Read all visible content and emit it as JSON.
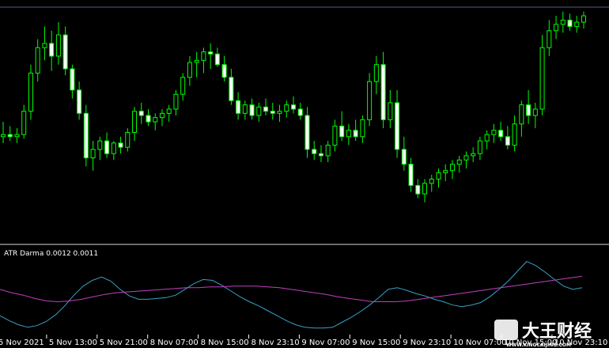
{
  "indicator": {
    "title": "ATR Darma 0.0012 0.0011"
  },
  "colors": {
    "background": "#000000",
    "candle_bull": "#00ff00",
    "candle_bear": "#00ff00",
    "candle_bull_fill": "#000000",
    "candle_bear_fill": "#ffffff",
    "indicator_fast": "#3aa0c8",
    "indicator_slow": "#c040c0",
    "separator": "#d8d8d8",
    "text": "#ffffff"
  },
  "watermark": {
    "text": "大王财经",
    "url_text": "WWW.KINGCAIJING.COM"
  },
  "chart_data": [
    {
      "type": "candlestick",
      "title": "",
      "x_tick_labels": [
        "5 Nov 2021",
        "5 Nov 13:00",
        "5 Nov 21:00",
        "8 Nov 07:00",
        "8 Nov 15:00",
        "8 Nov 23:10",
        "9 Nov 07:00",
        "9 Nov 15:00",
        "9 Nov 23:10",
        "10 Nov 07:00",
        "10 Nov 15:00",
        "10 Nov 23:10"
      ],
      "price_range": [
        0,
        100
      ],
      "grid": false,
      "candles": [
        {
          "o": 40,
          "h": 47,
          "l": 37,
          "c": 41
        },
        {
          "o": 41,
          "h": 45,
          "l": 38,
          "c": 40
        },
        {
          "o": 40,
          "h": 44,
          "l": 37,
          "c": 41
        },
        {
          "o": 41,
          "h": 55,
          "l": 39,
          "c": 52
        },
        {
          "o": 52,
          "h": 74,
          "l": 48,
          "c": 70
        },
        {
          "o": 70,
          "h": 86,
          "l": 66,
          "c": 82
        },
        {
          "o": 82,
          "h": 92,
          "l": 76,
          "c": 84
        },
        {
          "o": 84,
          "h": 90,
          "l": 71,
          "c": 78
        },
        {
          "o": 78,
          "h": 94,
          "l": 74,
          "c": 88
        },
        {
          "o": 88,
          "h": 92,
          "l": 69,
          "c": 72
        },
        {
          "o": 72,
          "h": 74,
          "l": 58,
          "c": 62
        },
        {
          "o": 62,
          "h": 66,
          "l": 48,
          "c": 51
        },
        {
          "o": 51,
          "h": 55,
          "l": 26,
          "c": 30
        },
        {
          "o": 30,
          "h": 38,
          "l": 24,
          "c": 34
        },
        {
          "o": 34,
          "h": 40,
          "l": 29,
          "c": 38
        },
        {
          "o": 38,
          "h": 42,
          "l": 30,
          "c": 32
        },
        {
          "o": 32,
          "h": 38,
          "l": 29,
          "c": 37
        },
        {
          "o": 37,
          "h": 40,
          "l": 32,
          "c": 35
        },
        {
          "o": 35,
          "h": 44,
          "l": 33,
          "c": 42
        },
        {
          "o": 42,
          "h": 54,
          "l": 38,
          "c": 52
        },
        {
          "o": 52,
          "h": 56,
          "l": 46,
          "c": 50
        },
        {
          "o": 50,
          "h": 53,
          "l": 45,
          "c": 47
        },
        {
          "o": 47,
          "h": 51,
          "l": 43,
          "c": 49
        },
        {
          "o": 49,
          "h": 53,
          "l": 45,
          "c": 51
        },
        {
          "o": 51,
          "h": 55,
          "l": 47,
          "c": 53
        },
        {
          "o": 53,
          "h": 62,
          "l": 50,
          "c": 60
        },
        {
          "o": 60,
          "h": 70,
          "l": 57,
          "c": 68
        },
        {
          "o": 68,
          "h": 78,
          "l": 64,
          "c": 75
        },
        {
          "o": 75,
          "h": 80,
          "l": 68,
          "c": 76
        },
        {
          "o": 76,
          "h": 82,
          "l": 70,
          "c": 80
        },
        {
          "o": 80,
          "h": 84,
          "l": 72,
          "c": 79
        },
        {
          "o": 79,
          "h": 82,
          "l": 73,
          "c": 74
        },
        {
          "o": 74,
          "h": 78,
          "l": 66,
          "c": 68
        },
        {
          "o": 68,
          "h": 72,
          "l": 55,
          "c": 57
        },
        {
          "o": 57,
          "h": 61,
          "l": 48,
          "c": 51
        },
        {
          "o": 51,
          "h": 57,
          "l": 48,
          "c": 55
        },
        {
          "o": 55,
          "h": 58,
          "l": 48,
          "c": 50
        },
        {
          "o": 50,
          "h": 56,
          "l": 47,
          "c": 54
        },
        {
          "o": 54,
          "h": 58,
          "l": 50,
          "c": 52
        },
        {
          "o": 52,
          "h": 56,
          "l": 48,
          "c": 51
        },
        {
          "o": 51,
          "h": 55,
          "l": 47,
          "c": 52
        },
        {
          "o": 52,
          "h": 57,
          "l": 49,
          "c": 55
        },
        {
          "o": 55,
          "h": 59,
          "l": 51,
          "c": 53
        },
        {
          "o": 53,
          "h": 56,
          "l": 48,
          "c": 50
        },
        {
          "o": 50,
          "h": 54,
          "l": 30,
          "c": 34
        },
        {
          "o": 34,
          "h": 38,
          "l": 29,
          "c": 32
        },
        {
          "o": 32,
          "h": 36,
          "l": 28,
          "c": 31
        },
        {
          "o": 31,
          "h": 38,
          "l": 28,
          "c": 36
        },
        {
          "o": 36,
          "h": 48,
          "l": 33,
          "c": 45
        },
        {
          "o": 45,
          "h": 52,
          "l": 38,
          "c": 40
        },
        {
          "o": 40,
          "h": 46,
          "l": 36,
          "c": 43
        },
        {
          "o": 43,
          "h": 48,
          "l": 38,
          "c": 40
        },
        {
          "o": 40,
          "h": 50,
          "l": 37,
          "c": 48
        },
        {
          "o": 48,
          "h": 70,
          "l": 45,
          "c": 66
        },
        {
          "o": 66,
          "h": 78,
          "l": 60,
          "c": 74
        },
        {
          "o": 74,
          "h": 80,
          "l": 44,
          "c": 48
        },
        {
          "o": 48,
          "h": 62,
          "l": 44,
          "c": 56
        },
        {
          "o": 56,
          "h": 62,
          "l": 30,
          "c": 34
        },
        {
          "o": 34,
          "h": 40,
          "l": 24,
          "c": 27
        },
        {
          "o": 27,
          "h": 30,
          "l": 14,
          "c": 17
        },
        {
          "o": 17,
          "h": 20,
          "l": 11,
          "c": 13
        },
        {
          "o": 13,
          "h": 20,
          "l": 9,
          "c": 18
        },
        {
          "o": 18,
          "h": 22,
          "l": 14,
          "c": 20
        },
        {
          "o": 20,
          "h": 25,
          "l": 16,
          "c": 23
        },
        {
          "o": 23,
          "h": 27,
          "l": 19,
          "c": 24
        },
        {
          "o": 24,
          "h": 29,
          "l": 20,
          "c": 27
        },
        {
          "o": 27,
          "h": 31,
          "l": 23,
          "c": 29
        },
        {
          "o": 29,
          "h": 33,
          "l": 25,
          "c": 31
        },
        {
          "o": 31,
          "h": 35,
          "l": 28,
          "c": 32
        },
        {
          "o": 32,
          "h": 40,
          "l": 29,
          "c": 38
        },
        {
          "o": 38,
          "h": 43,
          "l": 34,
          "c": 41
        },
        {
          "o": 41,
          "h": 46,
          "l": 37,
          "c": 43
        },
        {
          "o": 43,
          "h": 47,
          "l": 38,
          "c": 40
        },
        {
          "o": 40,
          "h": 45,
          "l": 34,
          "c": 36
        },
        {
          "o": 36,
          "h": 50,
          "l": 33,
          "c": 46
        },
        {
          "o": 46,
          "h": 57,
          "l": 40,
          "c": 55
        },
        {
          "o": 55,
          "h": 62,
          "l": 46,
          "c": 50
        },
        {
          "o": 50,
          "h": 56,
          "l": 44,
          "c": 53
        },
        {
          "o": 53,
          "h": 88,
          "l": 50,
          "c": 82
        },
        {
          "o": 82,
          "h": 95,
          "l": 78,
          "c": 90
        },
        {
          "o": 90,
          "h": 97,
          "l": 86,
          "c": 93
        },
        {
          "o": 93,
          "h": 99,
          "l": 89,
          "c": 95
        },
        {
          "o": 95,
          "h": 98,
          "l": 90,
          "c": 92
        },
        {
          "o": 92,
          "h": 97,
          "l": 89,
          "c": 94
        },
        {
          "o": 94,
          "h": 99,
          "l": 91,
          "c": 97
        }
      ]
    },
    {
      "type": "line",
      "title": "ATR Darma 0.0012 0.0011",
      "series": [
        {
          "values": [
            20,
            14,
            9,
            6,
            8,
            13,
            21,
            32,
            45,
            56,
            63,
            67,
            62,
            52,
            44,
            40,
            40,
            41,
            42,
            45,
            52,
            59,
            64,
            63,
            57,
            50,
            43,
            37,
            32,
            26,
            20,
            14,
            9,
            6,
            5,
            5,
            6,
            12,
            18,
            25,
            33,
            42,
            52,
            54,
            51,
            47,
            44,
            40,
            37,
            33,
            31,
            33,
            36,
            43,
            52,
            62,
            74,
            86,
            81,
            73,
            64,
            56,
            52,
            54
          ]
        },
        {
          "values": [
            52,
            48,
            45,
            41,
            38,
            37,
            38,
            40,
            43,
            46,
            48,
            49,
            50,
            51,
            52,
            53,
            54,
            54,
            55,
            55,
            56,
            56,
            56,
            55,
            54,
            52,
            50,
            48,
            46,
            43,
            41,
            39,
            37,
            37,
            37,
            38,
            40,
            42,
            44,
            46,
            48,
            50,
            52,
            54,
            56,
            58,
            60,
            62,
            64,
            66,
            68
          ]
        }
      ]
    }
  ]
}
